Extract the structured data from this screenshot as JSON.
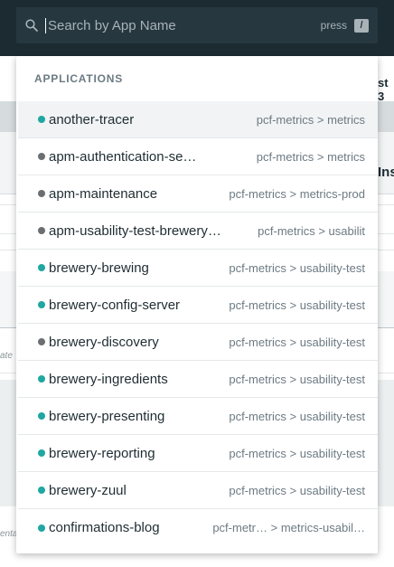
{
  "search": {
    "placeholder": "Search by App Name",
    "value": "",
    "hint": "press",
    "shortcut_key": "/"
  },
  "dropdown": {
    "section_title": "APPLICATIONS",
    "items": [
      {
        "name": "another-tracer",
        "path": "pcf-metrics > metrics",
        "status": "running"
      },
      {
        "name": "apm-authentication-se…",
        "path": "pcf-metrics > metrics",
        "status": "stopped"
      },
      {
        "name": "apm-maintenance",
        "path": "pcf-metrics > metrics-prod",
        "status": "stopped"
      },
      {
        "name": "apm-usability-test-brewery…",
        "path": "pcf-metrics > usabilit",
        "status": "stopped"
      },
      {
        "name": "brewery-brewing",
        "path": "pcf-metrics > usability-test",
        "status": "running"
      },
      {
        "name": "brewery-config-server",
        "path": "pcf-metrics > usability-test",
        "status": "running"
      },
      {
        "name": "brewery-discovery",
        "path": "pcf-metrics > usability-test",
        "status": "stopped"
      },
      {
        "name": "brewery-ingredients",
        "path": "pcf-metrics > usability-test",
        "status": "running"
      },
      {
        "name": "brewery-presenting",
        "path": "pcf-metrics > usability-test",
        "status": "running"
      },
      {
        "name": "brewery-reporting",
        "path": "pcf-metrics > usability-test",
        "status": "running"
      },
      {
        "name": "brewery-zuul",
        "path": "pcf-metrics > usability-test",
        "status": "running"
      },
      {
        "name": "confirmations-blog",
        "path": "pcf-metr… > metrics-usabil…",
        "status": "running"
      }
    ]
  },
  "background": {
    "header_fragment": "st 3",
    "panel_fragment": "Ins",
    "chart_label_1": "ate",
    "chart_label_2": "enta"
  },
  "colors": {
    "running": "#1fa7a0",
    "stopped": "#6b6f72",
    "search_bg": "#263740",
    "panel_bg": "#ffffff",
    "header_text": "#6c7a83"
  },
  "icons": {
    "search": "search-icon"
  }
}
